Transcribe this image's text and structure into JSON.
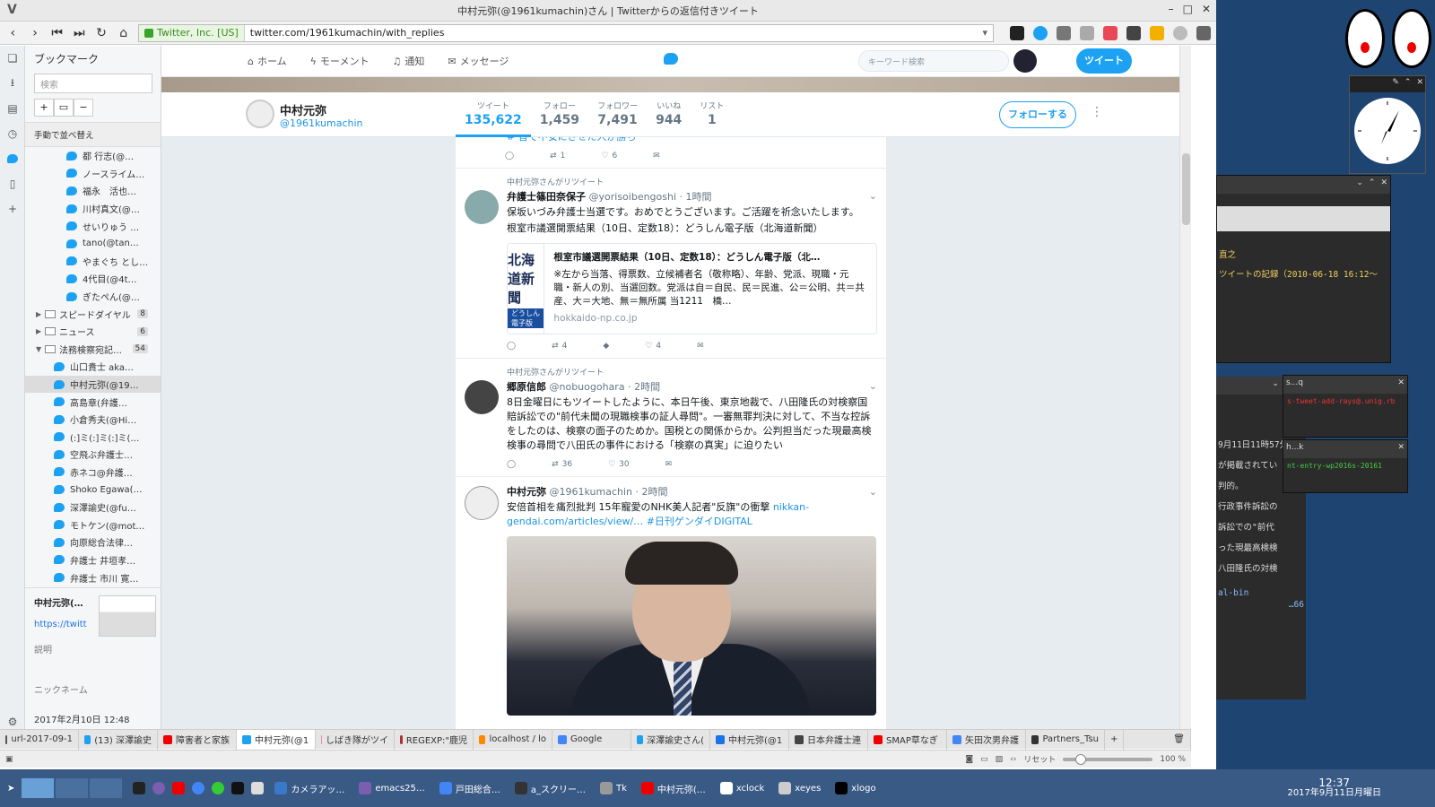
{
  "window": {
    "title": "中村元弥(@1961kumachin)さん | Twitterからの返信付きツイート"
  },
  "address": {
    "security": "Twitter, Inc. [US]",
    "url": "twitter.com/1961kumachin/with_replies"
  },
  "bookmarks": {
    "title": "ブックマーク",
    "search_placeholder": "検索",
    "sort_label": "手動で並べ替え",
    "items": [
      {
        "type": "tw",
        "label": "都 行志(@…",
        "indent": 2
      },
      {
        "type": "tw",
        "label": "ノースライム…",
        "indent": 2
      },
      {
        "type": "tw",
        "label": "福永　活也…",
        "indent": 2
      },
      {
        "type": "tw",
        "label": "川村真文(@…",
        "indent": 2
      },
      {
        "type": "tw",
        "label": "せいりゅう …",
        "indent": 2
      },
      {
        "type": "tw",
        "label": "tano(@tan…",
        "indent": 2
      },
      {
        "type": "tw",
        "label": "やまぐち とし…",
        "indent": 2
      },
      {
        "type": "tw",
        "label": "4代目(@4t…",
        "indent": 2
      },
      {
        "type": "tw",
        "label": "ぎたぺん(@…",
        "indent": 2
      },
      {
        "type": "folder",
        "label": "スピードダイヤル",
        "count": "8",
        "caret": "▶"
      },
      {
        "type": "folder",
        "label": "ニュース",
        "count": "6",
        "caret": "▶"
      },
      {
        "type": "folder",
        "label": "法務検察宛記…",
        "count": "54",
        "caret": "▼"
      },
      {
        "type": "tw",
        "label": "山口貴士 aka…",
        "indent": 1
      },
      {
        "type": "tw",
        "label": "中村元弥(@19…",
        "indent": 1,
        "selected": true
      },
      {
        "type": "tw",
        "label": "高島章(弁護…",
        "indent": 1
      },
      {
        "type": "tw",
        "label": "小倉秀夫(@Hi…",
        "indent": 1
      },
      {
        "type": "tw",
        "label": "(:]ミ(:]ミ(:]ミ(…",
        "indent": 1
      },
      {
        "type": "tw",
        "label": "空飛ぶ弁護士…",
        "indent": 1
      },
      {
        "type": "tw",
        "label": "赤ネコ@弁護…",
        "indent": 1
      },
      {
        "type": "tw",
        "label": "Shoko Egawa(…",
        "indent": 1
      },
      {
        "type": "tw",
        "label": "深澤諭史(@fu…",
        "indent": 1
      },
      {
        "type": "tw",
        "label": "モトケン(@mot…",
        "indent": 1
      },
      {
        "type": "tw",
        "label": "向原総合法律…",
        "indent": 1
      },
      {
        "type": "tw",
        "label": "弁護士 井垣孝…",
        "indent": 1
      },
      {
        "type": "tw",
        "label": "弁護士 市川 寛…",
        "indent": 1
      }
    ],
    "detail": {
      "name": "中村元弥(…",
      "link": "https://twitt",
      "desc_label": "説明",
      "nick_label": "ニックネーム",
      "date": "2017年2月10日 12:48"
    }
  },
  "twitter": {
    "nav": {
      "home": "ホーム",
      "moments": "モーメント",
      "notifications": "通知",
      "messages": "メッセージ"
    },
    "search_placeholder": "キーワード検索",
    "tweet_button": "ツイート",
    "profile": {
      "name": "中村元弥",
      "handle": "@1961kumachin",
      "follow_button": "フォローする"
    },
    "stats": [
      {
        "label": "ツイート",
        "value": "135,622"
      },
      {
        "label": "フォロー",
        "value": "1,459"
      },
      {
        "label": "フォロワー",
        "value": "7,491"
      },
      {
        "label": "いいね",
        "value": "944"
      },
      {
        "label": "リスト",
        "value": "1"
      }
    ],
    "tweets": {
      "t0": {
        "cut_text": "# 音で不安にさせた人が勝ち",
        "retweets": "1",
        "likes": "6"
      },
      "t1": {
        "rt_by": "中村元弥さんがリツイート",
        "name": "弁護士篠田奈保子",
        "handle": "@yorisoibengoshi",
        "time": "1時間",
        "text1": "保坂いづみ弁護士当選です。おめでとうございます。ご活躍を祈念いたします。",
        "text2": "根室市議選開票結果（10日、定数18）：どうしん電子版（北海道新聞）",
        "card_logo": "北海道新聞",
        "card_logo_sub": "どうしん電子版",
        "card_title": "根室市議選開票結果（10日、定数18）：どうしん電子版（北…",
        "card_desc": "※左から当落、得票数、立候補者名（敬称略）、年齢、党派、現職・元職・新人の別、当選回数。党派は自＝自民、民＝民進、公＝公明、共＝共産、大＝大地、無＝無所属 当1211　橋…",
        "card_domain": "hokkaido-np.co.jp",
        "retweets": "4",
        "likes": "4"
      },
      "t2": {
        "rt_by": "中村元弥さんがリツイート",
        "name": "郷原信郎",
        "handle": "@nobuogohara",
        "time": "2時間",
        "text": "8日金曜日にもツイートしたように、本日午後、東京地裁で、八田隆氏の対検察国賠訴訟での\"前代未聞の現職検事の証人尋問\"。一審無罪判決に対して、不当な控訴をしたのは、検察の面子のためか。国税との関係からか。公判担当だった現最高検検事の尋問で八田氏の事件における「検察の真実」に迫りたい",
        "retweets": "36",
        "likes": "30"
      },
      "t3": {
        "name": "中村元弥",
        "handle": "@1961kumachin",
        "time": "2時間",
        "text": "安倍首相を痛烈批判 15年寵愛のNHK美人記者\"反旗\"の衝撃 ",
        "link1": "nikkan-gendai.com/articles/view/…",
        "hashtag": "#日刊ゲンダイDIGITAL"
      }
    }
  },
  "tabs": [
    {
      "label": "url-2017-09-1",
      "color": "#555"
    },
    {
      "label": "(13) 深澤諭史",
      "color": "#1da1f2"
    },
    {
      "label": "障害者と家族",
      "color": "#e00"
    },
    {
      "label": "中村元弥(@1",
      "color": "#1da1f2",
      "active": true
    },
    {
      "label": "しばき隊がツイ",
      "color": "#e8a"
    },
    {
      "label": "REGEXP:\"鹿児",
      "color": "#a33"
    },
    {
      "label": "localhost / lo",
      "color": "#f80"
    },
    {
      "label": "Google",
      "color": "#4285f4"
    },
    {
      "label": "深澤諭史さん(",
      "color": "#1da1f2"
    },
    {
      "label": "中村元弥(@1",
      "color": "#1a73e8"
    },
    {
      "label": "日本弁護士連",
      "color": "#444"
    },
    {
      "label": "SMAP草なぎ",
      "color": "#e00"
    },
    {
      "label": "矢田次男弁護",
      "color": "#4285f4"
    },
    {
      "label": "Partners_Tsu",
      "color": "#333"
    }
  ],
  "status": {
    "reset": "リセット",
    "zoom": "100 %",
    "zoom_fraction": 0.2
  },
  "taskbar": {
    "apps": [
      {
        "label": "カメラアッ…",
        "color": "#3a78c9"
      },
      {
        "label": "emacs25…",
        "color": "#7a5fb0"
      },
      {
        "label": "戸田総合…",
        "color": "#4285f4"
      },
      {
        "label": "a_スクリー…",
        "color": "#333"
      },
      {
        "label": "Tk",
        "color": "#999"
      },
      {
        "label": "中村元弥(…",
        "color": "#e00"
      },
      {
        "label": "xclock",
        "color": "#fff"
      },
      {
        "label": "xeyes",
        "color": "#ccc"
      },
      {
        "label": "xlogo",
        "color": "#000"
      }
    ],
    "time": "12:37",
    "date": "2017年9月11日月曜日"
  },
  "desktop": {
    "term_line1": "直之",
    "term_line2": "ツイートの記録（2010-06-18 16:12〜",
    "mini1_title": "s...q",
    "mini1_text": "s-tweet-add-rays@.unig.rb",
    "mini2_title": "h...k",
    "mini2_text": "nt-entry-wp2016s-20161",
    "side_text": [
      "9月11日11時57分",
      "が掲載されてい",
      "判的。",
      "行政事件訴訟の",
      "訴訟での\"前代",
      "った現最高検検",
      "八田隆氏の対検"
    ],
    "side_bottom": "al-bin",
    "side_bottom2": "…66"
  }
}
